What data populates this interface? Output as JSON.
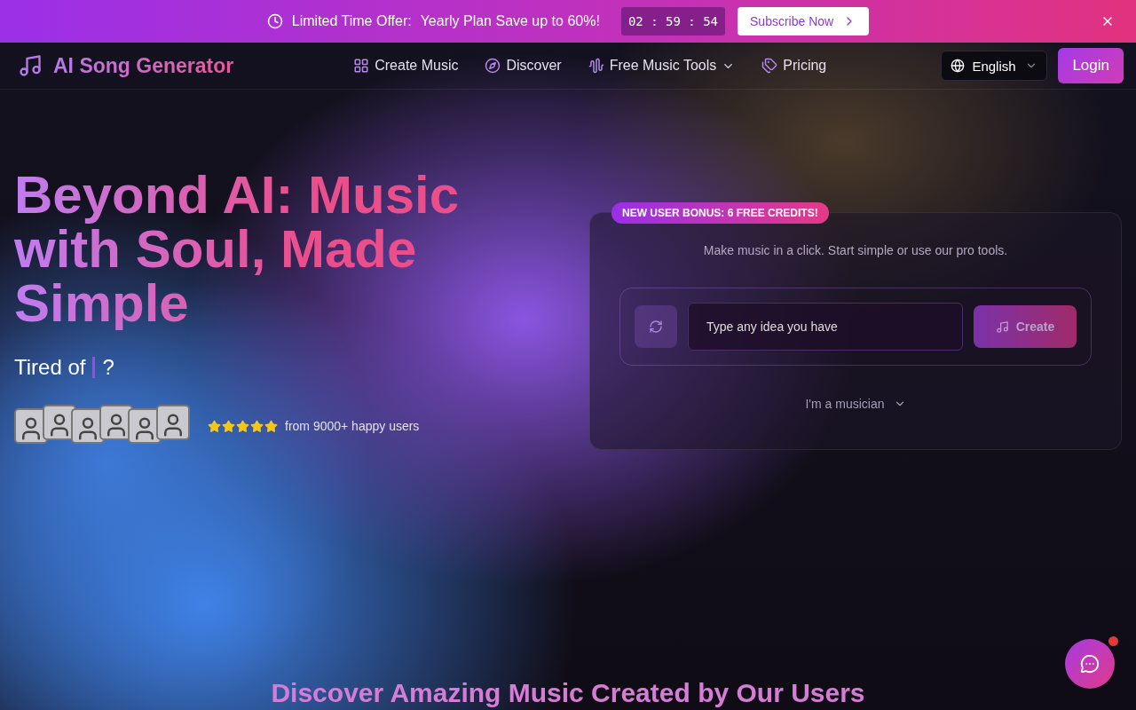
{
  "promo_banner": {
    "label": "Limited Time Offer:",
    "offer": "Yearly Plan Save up to 60%!",
    "countdown": "02 : 59 : 54",
    "button": "Subscribe Now"
  },
  "navbar": {
    "logo": "AI Song Generator",
    "links": [
      {
        "label": "Create Music",
        "has_menu": false
      },
      {
        "label": "Discover",
        "has_menu": false
      },
      {
        "label": "Free Music Tools",
        "has_menu": true
      },
      {
        "label": "Pricing",
        "has_menu": false
      }
    ],
    "language": "English",
    "login": "Login"
  },
  "hero": {
    "title": "Beyond AI: Music with Soul, Made Simple",
    "subtitle_start": "Tired of",
    "subtitle_end": "?",
    "stars": 5,
    "users_text": "from 9000+ happy users"
  },
  "create_card": {
    "badge": "NEW USER BONUS: 6 FREE CREDITS!",
    "intro": "Make music in a click. Start simple or use our pro tools.",
    "prompt": {
      "placeholder": "Type any idea you have"
    },
    "create_button": "Create",
    "mode": "I'm a musician"
  },
  "section_heading": "Discover Amazing Music Created by Our Users"
}
